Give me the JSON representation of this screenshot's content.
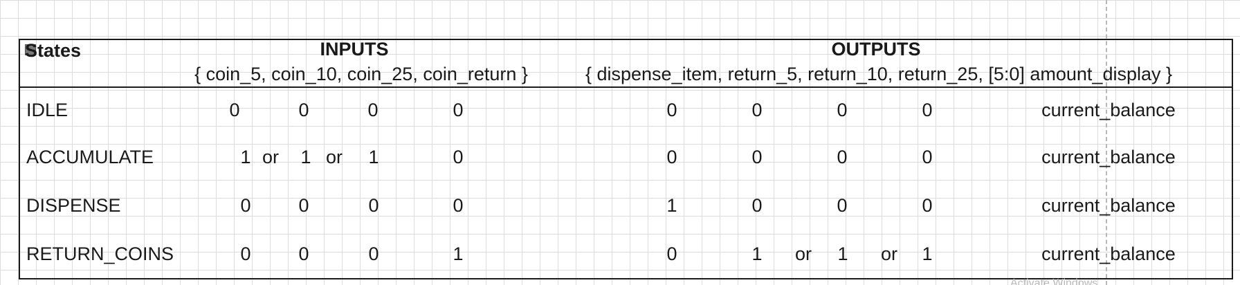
{
  "header": {
    "states_label": "States",
    "inputs_title": "INPUTS",
    "inputs_signals": "{ coin_5, coin_10, coin_25, coin_return }",
    "outputs_title": "OUTPUTS",
    "outputs_signals": "{ dispense_item, return_5, return_10, return_25, [5:0] amount_display }"
  },
  "rows": [
    {
      "state": "IDLE",
      "inputs": [
        "0",
        "0",
        "0",
        "0"
      ],
      "outputs": [
        "0",
        "0",
        "0",
        "0"
      ],
      "display": "current_balance"
    },
    {
      "state": "ACCUMULATE",
      "inputs": [
        "1",
        "or",
        "1",
        "or",
        "1",
        "0"
      ],
      "outputs": [
        "0",
        "0",
        "0",
        "0"
      ],
      "display": "current_balance"
    },
    {
      "state": "DISPENSE",
      "inputs": [
        "0",
        "0",
        "0",
        "0"
      ],
      "outputs": [
        "1",
        "0",
        "0",
        "0"
      ],
      "display": "current_balance"
    },
    {
      "state": "RETURN_COINS",
      "inputs": [
        "0",
        "0",
        "0",
        "1"
      ],
      "outputs": [
        "0",
        "1",
        "or",
        "1",
        "or",
        "1"
      ],
      "display": "current_balance"
    }
  ],
  "watermark": "Activate Windows",
  "icons": {
    "collapse": "collapse-minus-icon"
  }
}
